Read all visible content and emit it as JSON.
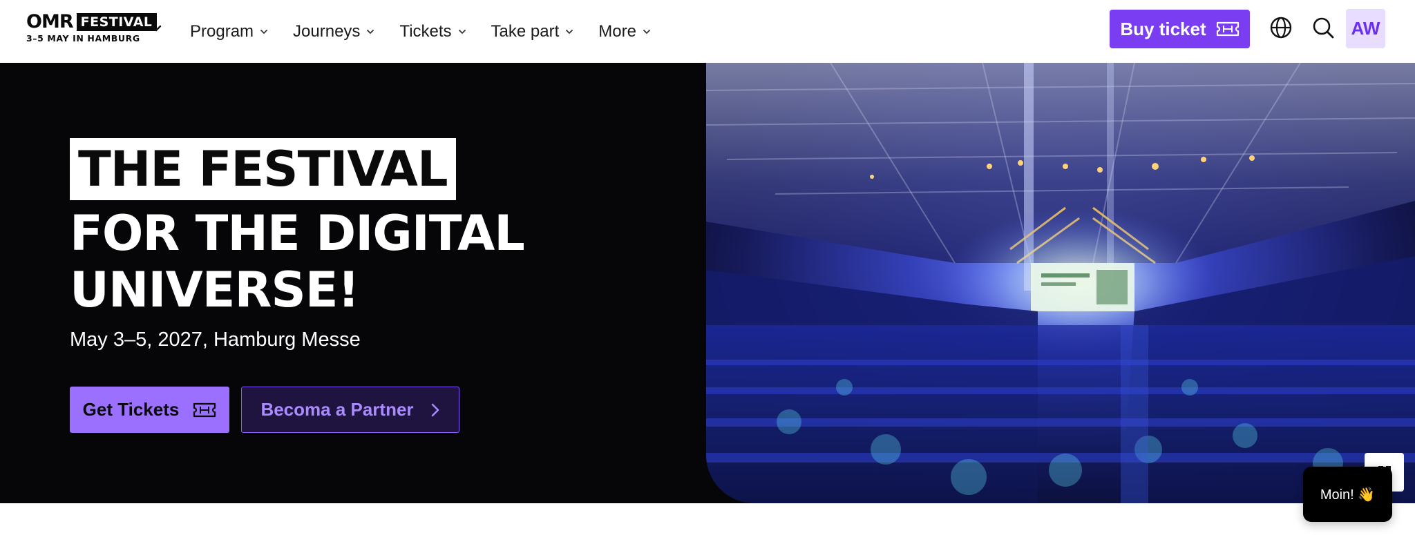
{
  "brand": {
    "logo_word": "OMR",
    "logo_badge": "FESTIVAL",
    "logo_tagline": "3–5 MAY IN HAMBURG"
  },
  "nav": {
    "items": [
      {
        "label": "Program"
      },
      {
        "label": "Journeys"
      },
      {
        "label": "Tickets"
      },
      {
        "label": "Take part"
      },
      {
        "label": "More"
      }
    ],
    "buy_label": "Buy ticket",
    "avatar_initials": "AW"
  },
  "hero": {
    "title_line1": "THE FESTIVAL",
    "title_line2": "FOR THE DIGITAL",
    "title_line3": "UNIVERSE!",
    "date_location": "May 3–5, 2027, Hamburg Messe",
    "primary_cta": "Get Tickets",
    "secondary_cta": "Becoma a Partner"
  },
  "chat": {
    "greeting": "Moin! 👋"
  },
  "colors": {
    "accent": "#7a3df2",
    "accent_light": "#9b70ff",
    "hero_bg": "#060609",
    "avatar_bg": "#e8dcff"
  },
  "icons": [
    "chevron-down-icon",
    "ticket-icon",
    "globe-icon",
    "search-icon",
    "chevron-right-icon",
    "panel-icon"
  ]
}
